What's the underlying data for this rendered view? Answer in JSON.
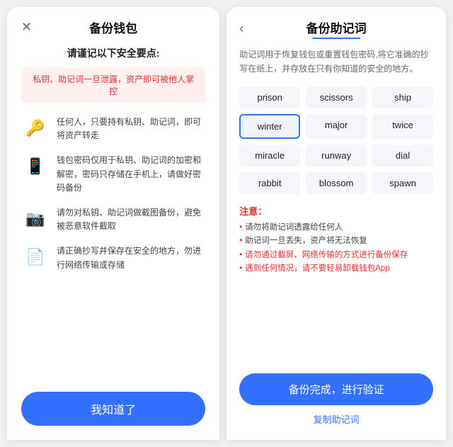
{
  "left": {
    "close_label": "✕",
    "title": "备份钱包",
    "safety_title": "请谨记以下安全要点:",
    "warning_text": "私钥、助记词一旦泄露，资产即可被他人掌控",
    "items": [
      {
        "icon": "🔑",
        "text": "任何人，只要持有私钥、助记词，即可将资产转走"
      },
      {
        "icon": "📱",
        "text": "钱包密码仅用于私钥、助记词的加密和解密，密码只存储在手机上，请做好密码备份"
      },
      {
        "icon": "📷",
        "text": "请勿对私钥、助记词做截图备份，避免被恶意软件截取"
      },
      {
        "icon": "📄",
        "text": "请正确抄写并保存在安全的地方，勿进行网络传输或存储"
      }
    ],
    "know_btn": "我知道了"
  },
  "right": {
    "back_label": "‹",
    "title": "备份助记词",
    "description": "助记词用于恢复钱包或重置钱包密码,将它准确的抄写在纸上，并存放在只有你知道的安全的地方。",
    "words": [
      {
        "text": "prison",
        "highlight": false
      },
      {
        "text": "scissors",
        "highlight": false
      },
      {
        "text": "ship",
        "highlight": false
      },
      {
        "text": "winter",
        "highlight": true
      },
      {
        "text": "major",
        "highlight": false
      },
      {
        "text": "twice",
        "highlight": false
      },
      {
        "text": "miracle",
        "highlight": false
      },
      {
        "text": "runway",
        "highlight": false
      },
      {
        "text": "dial",
        "highlight": false
      },
      {
        "text": "rabbit",
        "highlight": false
      },
      {
        "text": "blossom",
        "highlight": false
      },
      {
        "text": "spawn",
        "highlight": false
      }
    ],
    "notice_title": "注意：",
    "notices": [
      {
        "text": "请勿将助记词透露给任何人",
        "red": false
      },
      {
        "text": "助记词一旦丢失，资产将无法恢复",
        "red": false
      },
      {
        "text": "请勿通过截屏、网络传输的方式进行备份保存",
        "red": true
      },
      {
        "text": "遇到任何情况，请不要轻易卸载钱包App",
        "red": true
      }
    ],
    "backup_btn": "备份完成，进行验证",
    "copy_link": "复制助记词"
  }
}
